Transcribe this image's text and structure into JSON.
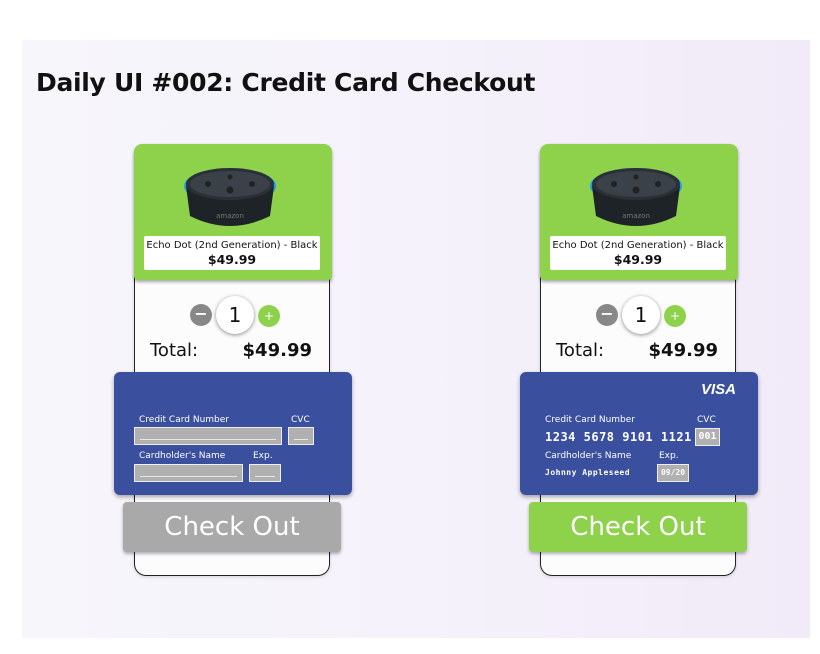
{
  "page": {
    "title": "Daily UI #002: Credit Card Checkout"
  },
  "colors": {
    "accent_green": "#8ed14b",
    "card_blue": "#3a4f9e",
    "disabled_gray": "#a9a9a9"
  },
  "screens": [
    {
      "state": "empty",
      "product": {
        "name": "Echo Dot (2nd Generation) - Black",
        "price": "$49.99",
        "image_icon": "echo-dot-speaker-icon",
        "image_text": "amazon"
      },
      "quantity": {
        "minus": "−",
        "value": "1",
        "plus": "+"
      },
      "total": {
        "label": "Total:",
        "value": "$49.99"
      },
      "card": {
        "number_label": "Credit Card Number",
        "number_value": "",
        "cvc_label": "CVC",
        "cvc_value": "",
        "holder_label": "Cardholder's Name",
        "holder_value": "",
        "exp_label": "Exp.",
        "exp_value": "",
        "brand": ""
      },
      "checkout_label": "Check Out",
      "checkout_enabled": false
    },
    {
      "state": "filled",
      "product": {
        "name": "Echo Dot (2nd Generation) - Black",
        "price": "$49.99",
        "image_icon": "echo-dot-speaker-icon",
        "image_text": "amazon"
      },
      "quantity": {
        "minus": "−",
        "value": "1",
        "plus": "+"
      },
      "total": {
        "label": "Total:",
        "value": "$49.99"
      },
      "card": {
        "number_label": "Credit Card Number",
        "number_value": "1234 5678 9101 1121",
        "cvc_label": "CVC",
        "cvc_value": "001",
        "holder_label": "Cardholder's Name",
        "holder_value": "Johnny Appleseed",
        "exp_label": "Exp.",
        "exp_value": "09/20",
        "brand": "VISA"
      },
      "checkout_label": "Check Out",
      "checkout_enabled": true
    }
  ]
}
